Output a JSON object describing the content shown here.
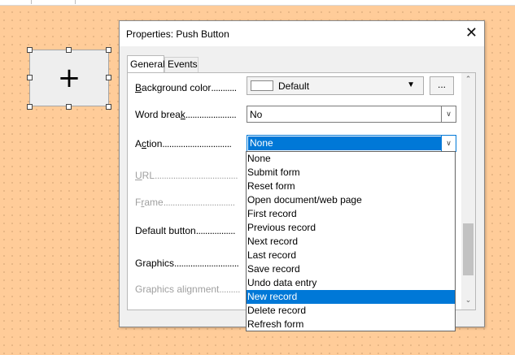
{
  "dialog": {
    "title": "Properties: Push Button",
    "close_glyph": "✕",
    "tabs": [
      {
        "label": "General",
        "active": true
      },
      {
        "label": "Events",
        "active": false
      }
    ]
  },
  "canvas_button": {
    "label": "+"
  },
  "fields": {
    "background_color": {
      "label_key": "B",
      "label_rest": "ackground color",
      "dots": "...........",
      "value": "Default",
      "browse_label": "..."
    },
    "word_break": {
      "label_pre": "Word brea",
      "label_key": "k",
      "dots": "......................",
      "value": "No"
    },
    "action": {
      "label_pre": "A",
      "label_key": "c",
      "label_rest": "tion",
      "dots": "..............................",
      "value": "None"
    },
    "url": {
      "label_key": "U",
      "label_rest": "RL",
      "dots": "...................................."
    },
    "frame": {
      "label_pre": "F",
      "label_key": "r",
      "label_rest": "ame",
      "dots": "..............................."
    },
    "default_button": {
      "label": "Default button",
      "dots": "................."
    },
    "graphics": {
      "label": "Graphics",
      "dots": "............................"
    },
    "graphics_alignment": {
      "label": "Graphics alignment",
      "dots": "........."
    }
  },
  "action_dropdown": {
    "options": [
      "None",
      "Submit form",
      "Reset form",
      "Open document/web page",
      "First record",
      "Previous record",
      "Next record",
      "Last record",
      "Save record",
      "Undo data entry",
      "New record",
      "Delete record",
      "Refresh form"
    ],
    "highlighted": "New record"
  },
  "colors": {
    "canvas_background": "#ffcc99",
    "selection": "#0078d7",
    "dialog_background": "#f0f0f0"
  }
}
